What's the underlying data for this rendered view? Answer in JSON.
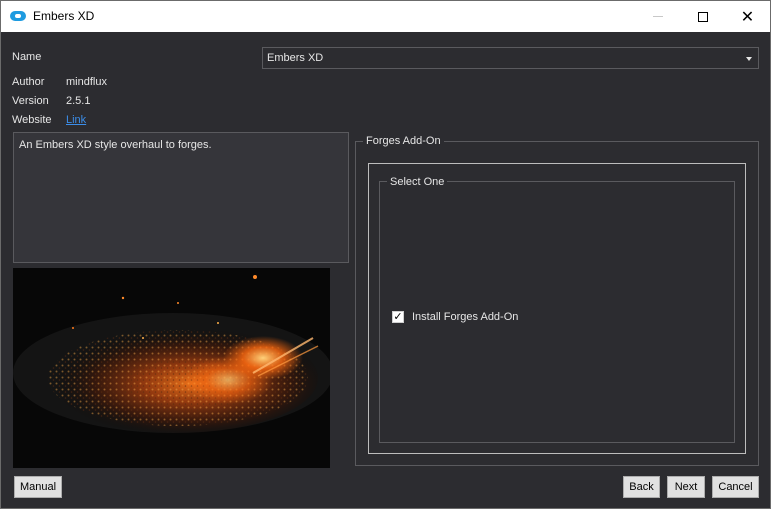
{
  "window": {
    "title": "Embers XD",
    "icon": "app-logo-icon",
    "controls": [
      "minimize-icon",
      "maximize-icon",
      "close-icon"
    ]
  },
  "info": {
    "name_label": "Name",
    "name_value": "Embers XD",
    "author_label": "Author",
    "author_value": "mindflux",
    "version_label": "Version",
    "version_value": "2.5.1",
    "website_label": "Website",
    "website_link": "Link"
  },
  "description": "An Embers XD style overhaul to forges.",
  "preview_image": "glowing forge embers photo",
  "addon_group": {
    "title": "Forges Add-On",
    "sub_title": "Select One",
    "option_label": "Install Forges Add-On",
    "option_checked": true
  },
  "buttons": {
    "manual": "Manual",
    "back": "Back",
    "next": "Next",
    "cancel": "Cancel"
  },
  "colors": {
    "background": "#2c2c30",
    "link": "#3b8eea",
    "accent_icon": "#1e9be0"
  }
}
